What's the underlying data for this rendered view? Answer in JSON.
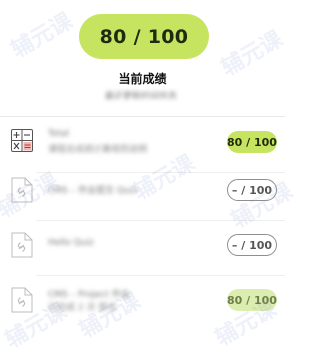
{
  "header": {
    "score": "80 / 100",
    "label": "当前成绩",
    "subtitle": "最近更新时间信息"
  },
  "rows": [
    {
      "icon": "calculator-icon",
      "title": "Total",
      "subtitle": "课程总成绩计算规则说明",
      "badge": "80 / 100",
      "badge_style": "filled"
    },
    {
      "icon": "link-document-icon",
      "title": "CMS – 作业提交 Quiz",
      "subtitle": "",
      "badge": "– / 100",
      "badge_style": "outline"
    },
    {
      "icon": "link-document-icon",
      "title": "Hello Quiz",
      "subtitle": "",
      "badge": "– / 100",
      "badge_style": "outline"
    },
    {
      "icon": "link-document-icon",
      "title": "CMS – Project 作业",
      "subtitle": "已完成 2 次 尝试",
      "badge": "80 / 100",
      "badge_style": "faded"
    }
  ],
  "colors": {
    "accent": "#c7e461",
    "accent_faded": "#dcedb0",
    "outline": "#8f8f8f"
  },
  "watermark": {
    "text": "辅元课"
  }
}
